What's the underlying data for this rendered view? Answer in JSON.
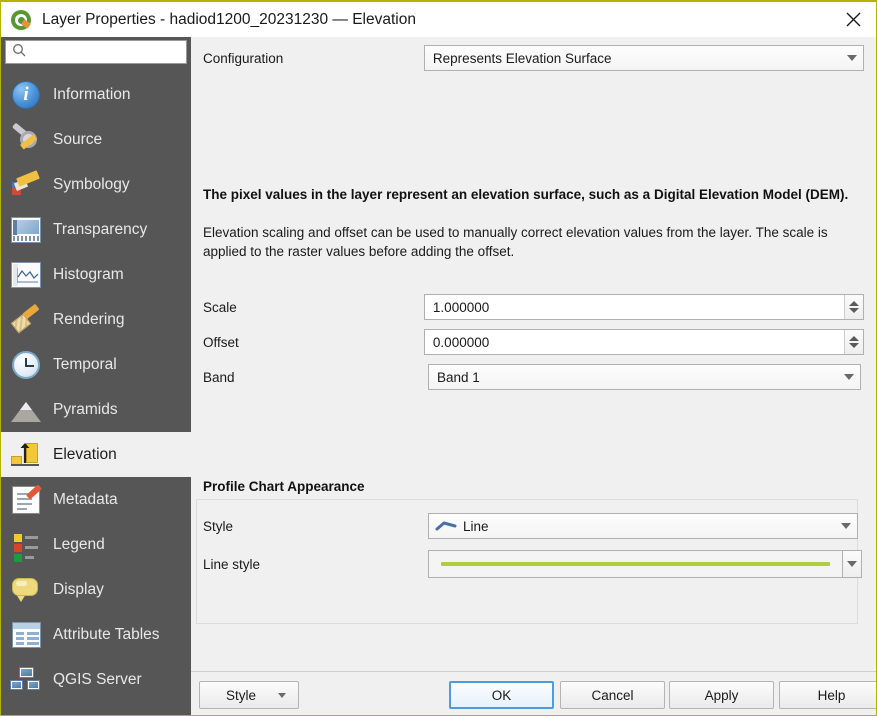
{
  "window": {
    "title": "Layer Properties - hadiod1200_20231230 — Elevation",
    "close_icon": "close-icon",
    "app_icon": "qgis-logo-icon"
  },
  "sidebar": {
    "search": {
      "value": "",
      "placeholder": "",
      "icon": "search-icon"
    },
    "items": [
      {
        "label": "Information",
        "icon": "information-icon",
        "selected": false
      },
      {
        "label": "Source",
        "icon": "source-icon",
        "selected": false
      },
      {
        "label": "Symbology",
        "icon": "symbology-icon",
        "selected": false
      },
      {
        "label": "Transparency",
        "icon": "transparency-icon",
        "selected": false
      },
      {
        "label": "Histogram",
        "icon": "histogram-icon",
        "selected": false
      },
      {
        "label": "Rendering",
        "icon": "rendering-icon",
        "selected": false
      },
      {
        "label": "Temporal",
        "icon": "temporal-icon",
        "selected": false
      },
      {
        "label": "Pyramids",
        "icon": "pyramids-icon",
        "selected": false
      },
      {
        "label": "Elevation",
        "icon": "elevation-icon",
        "selected": true
      },
      {
        "label": "Metadata",
        "icon": "metadata-icon",
        "selected": false
      },
      {
        "label": "Legend",
        "icon": "legend-icon",
        "selected": false
      },
      {
        "label": "Display",
        "icon": "display-icon",
        "selected": false
      },
      {
        "label": "Attribute Tables",
        "icon": "attribute-tables-icon",
        "selected": false
      },
      {
        "label": "QGIS Server",
        "icon": "qgis-server-icon",
        "selected": false
      }
    ]
  },
  "main": {
    "configuration": {
      "label": "Configuration",
      "value": "Represents Elevation Surface"
    },
    "description": {
      "bold": "The pixel values in the layer represent an elevation surface, such as a Digital Elevation Model (DEM).",
      "paragraph": "Elevation scaling and offset can be used to manually correct elevation values from the layer. The scale is applied to the raster values before adding the offset."
    },
    "fields": {
      "scale_label": "Scale",
      "scale_value": "1.000000",
      "offset_label": "Offset",
      "offset_value": "0.000000",
      "band_label": "Band",
      "band_value": "Band 1"
    },
    "profile_chart": {
      "title": "Profile Chart Appearance",
      "style_label": "Style",
      "style_value": "Line",
      "style_icon": "line-symbol-icon",
      "line_style_label": "Line style",
      "line_style_color": "#b3cb3e"
    }
  },
  "footer": {
    "style_button": "Style",
    "ok_button": "OK",
    "cancel_button": "Cancel",
    "apply_button": "Apply",
    "help_button": "Help"
  },
  "colors": {
    "sidebar_bg": "#565656",
    "content_bg": "#f0f0f0",
    "accent": "#4a9de0",
    "line_style": "#b3cb3e",
    "title_border": "#b4b400"
  }
}
